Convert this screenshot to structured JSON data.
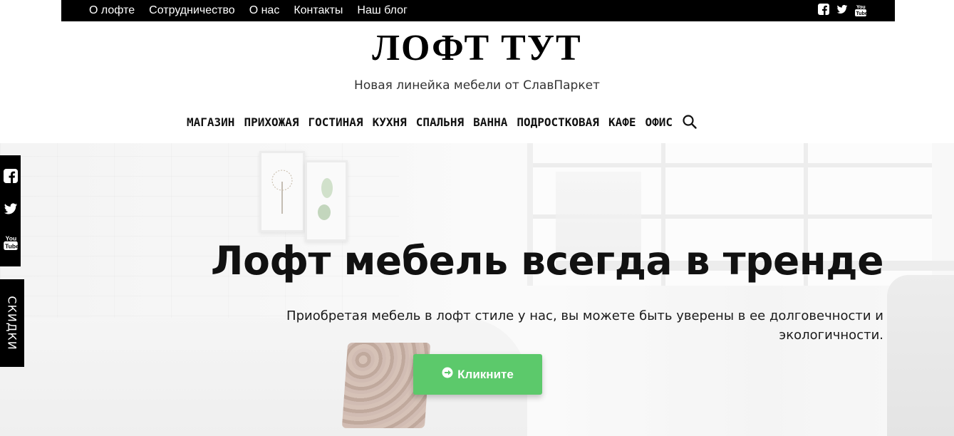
{
  "topbar": {
    "links": [
      "О лофте",
      "Сотрудничество",
      "О нас",
      "Контакты",
      "Наш блог"
    ],
    "social_icons": [
      "facebook-icon",
      "twitter-icon",
      "youtube-icon"
    ]
  },
  "brand": {
    "title": "ЛОФТ ТУТ",
    "tagline": "Новая линейка мебели от СлавПаркет"
  },
  "main_menu": {
    "items": [
      "МАГАЗИН",
      "ПРИХОЖАЯ",
      "ГОСТИНАЯ",
      "КУХНЯ",
      "СПАЛЬНЯ",
      "ВАННА",
      "ПОДРОСТКОВАЯ",
      "КАФЕ",
      "ОФИС"
    ],
    "search_icon": "search-icon"
  },
  "hero": {
    "title": "Лофт мебель всегда в тренде",
    "text": "Приобретая мебель в лофт стиле у нас, вы можете быть уверены в ее долговечности и экологичности.",
    "button_icon": "arrow-right-icon",
    "button_label": "Кликните",
    "button_color": "#5cc96b"
  },
  "side_widgets": {
    "social_icons": [
      "facebook-icon",
      "twitter-icon",
      "youtube-icon"
    ],
    "sale_tab_label": "СКИДКИ"
  }
}
